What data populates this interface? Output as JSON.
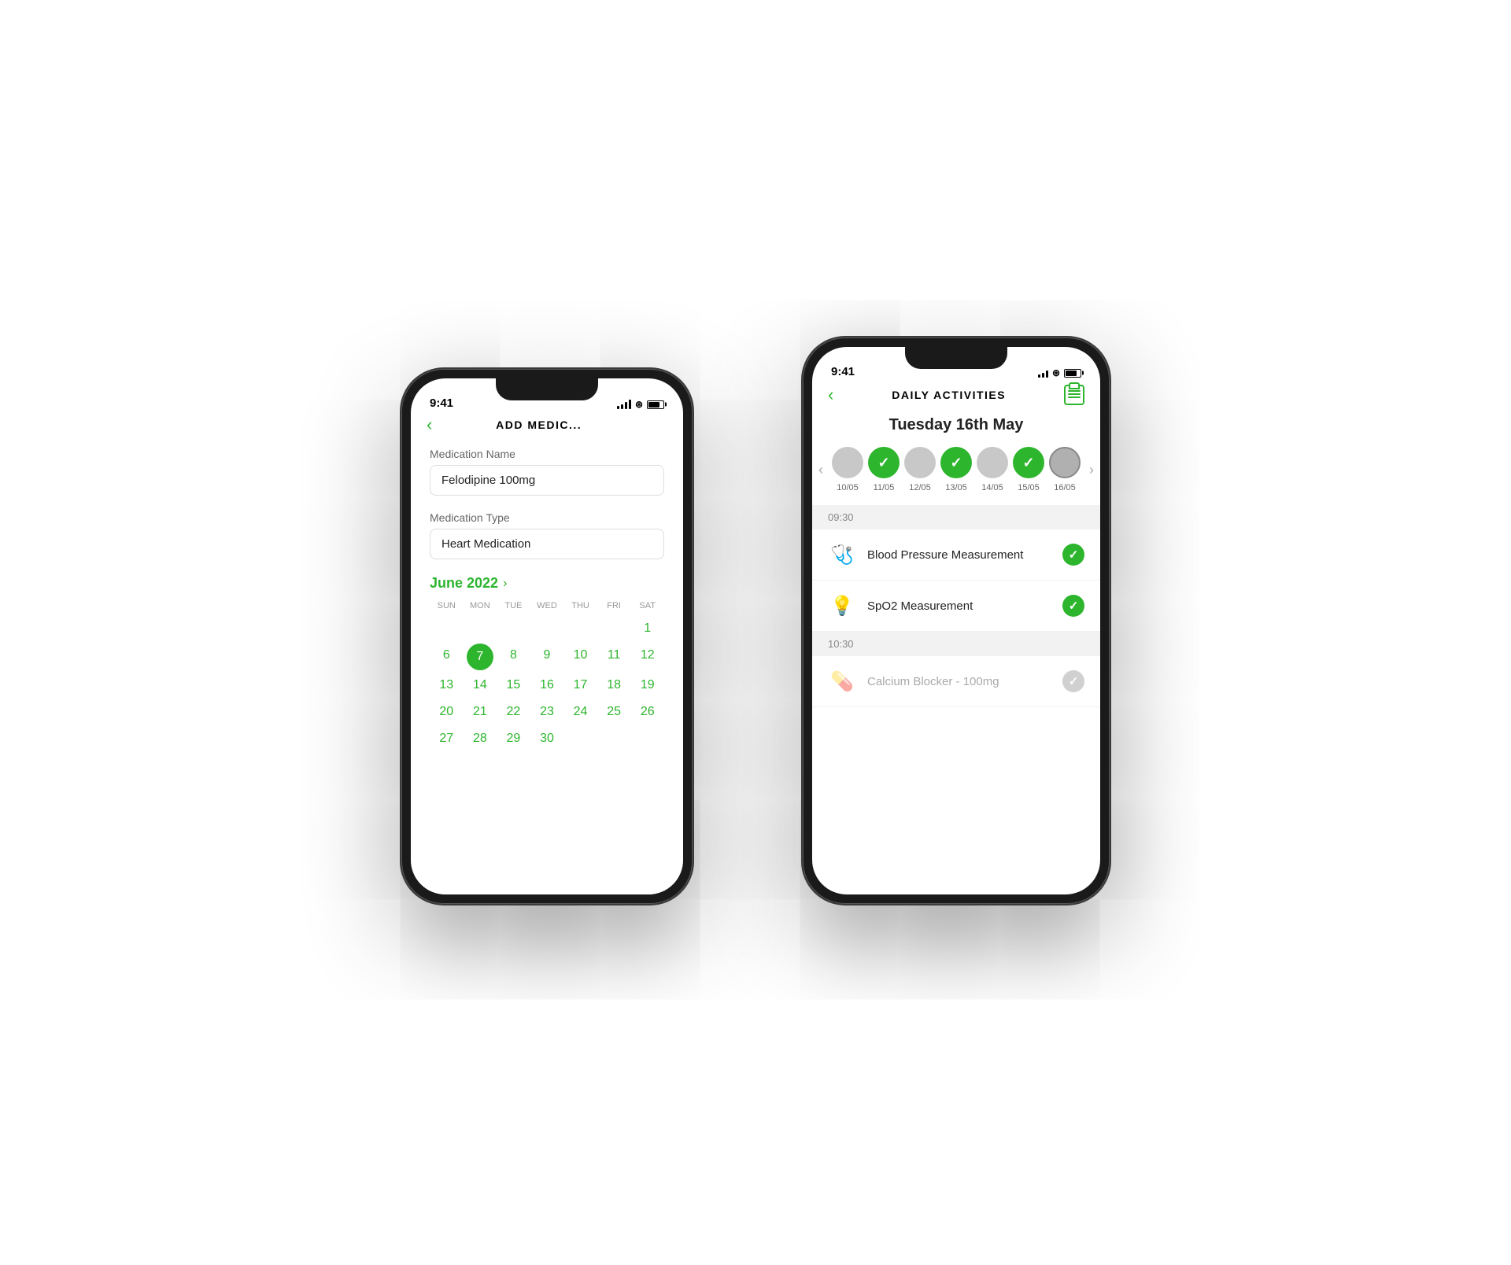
{
  "back_phone": {
    "status": {
      "time": "9:41",
      "signal": true,
      "wifi": true,
      "battery": true
    },
    "nav": {
      "back_label": "‹",
      "title": "ADD MEDIC..."
    },
    "fields": {
      "med_name_label": "Medication Name",
      "med_name_value": "Felodipine 100mg",
      "med_type_label": "Medication Type",
      "med_type_value": "Heart Medication"
    },
    "calendar": {
      "month_label": "June 2022",
      "arrow": "›",
      "day_names": [
        "SUN",
        "MON",
        "TUE",
        "WED",
        "THU",
        "FRI",
        "SAT"
      ],
      "weeks": [
        [
          "",
          "",
          "",
          "",
          "",
          "",
          "1"
        ],
        [
          "6",
          "7",
          "8",
          "9",
          "10",
          "11",
          "12"
        ],
        [
          "13",
          "14",
          "15",
          "16",
          "17",
          "18",
          "19"
        ],
        [
          "20",
          "21",
          "22",
          "23",
          "24",
          "25",
          "26"
        ],
        [
          "27",
          "28",
          "29",
          "30",
          "",
          "",
          ""
        ]
      ],
      "today": "7"
    }
  },
  "front_phone": {
    "status": {
      "time": "9:41",
      "signal": true,
      "wifi": true,
      "battery": true
    },
    "nav": {
      "back_label": "‹",
      "title": "DAILY ACTIVITIES"
    },
    "date_title": "Tuesday 16th May",
    "week_strip": {
      "prev": "‹",
      "next": "›",
      "days": [
        {
          "date": "10/05",
          "status": "pending"
        },
        {
          "date": "11/05",
          "status": "done"
        },
        {
          "date": "12/05",
          "status": "pending"
        },
        {
          "date": "13/05",
          "status": "done"
        },
        {
          "date": "14/05",
          "status": "pending"
        },
        {
          "date": "15/05",
          "status": "done"
        },
        {
          "date": "16/05",
          "status": "active"
        }
      ]
    },
    "time_sections": [
      {
        "time": "09:30",
        "activities": [
          {
            "icon": "🩺",
            "label": "Blood Pressure Measurement",
            "status": "done"
          },
          {
            "icon": "💡",
            "label": "SpO2 Measurement",
            "status": "done"
          }
        ]
      },
      {
        "time": "10:30",
        "activities": [
          {
            "icon": "💊",
            "label": "Calcium Blocker - 100mg",
            "status": "muted"
          }
        ]
      }
    ]
  }
}
